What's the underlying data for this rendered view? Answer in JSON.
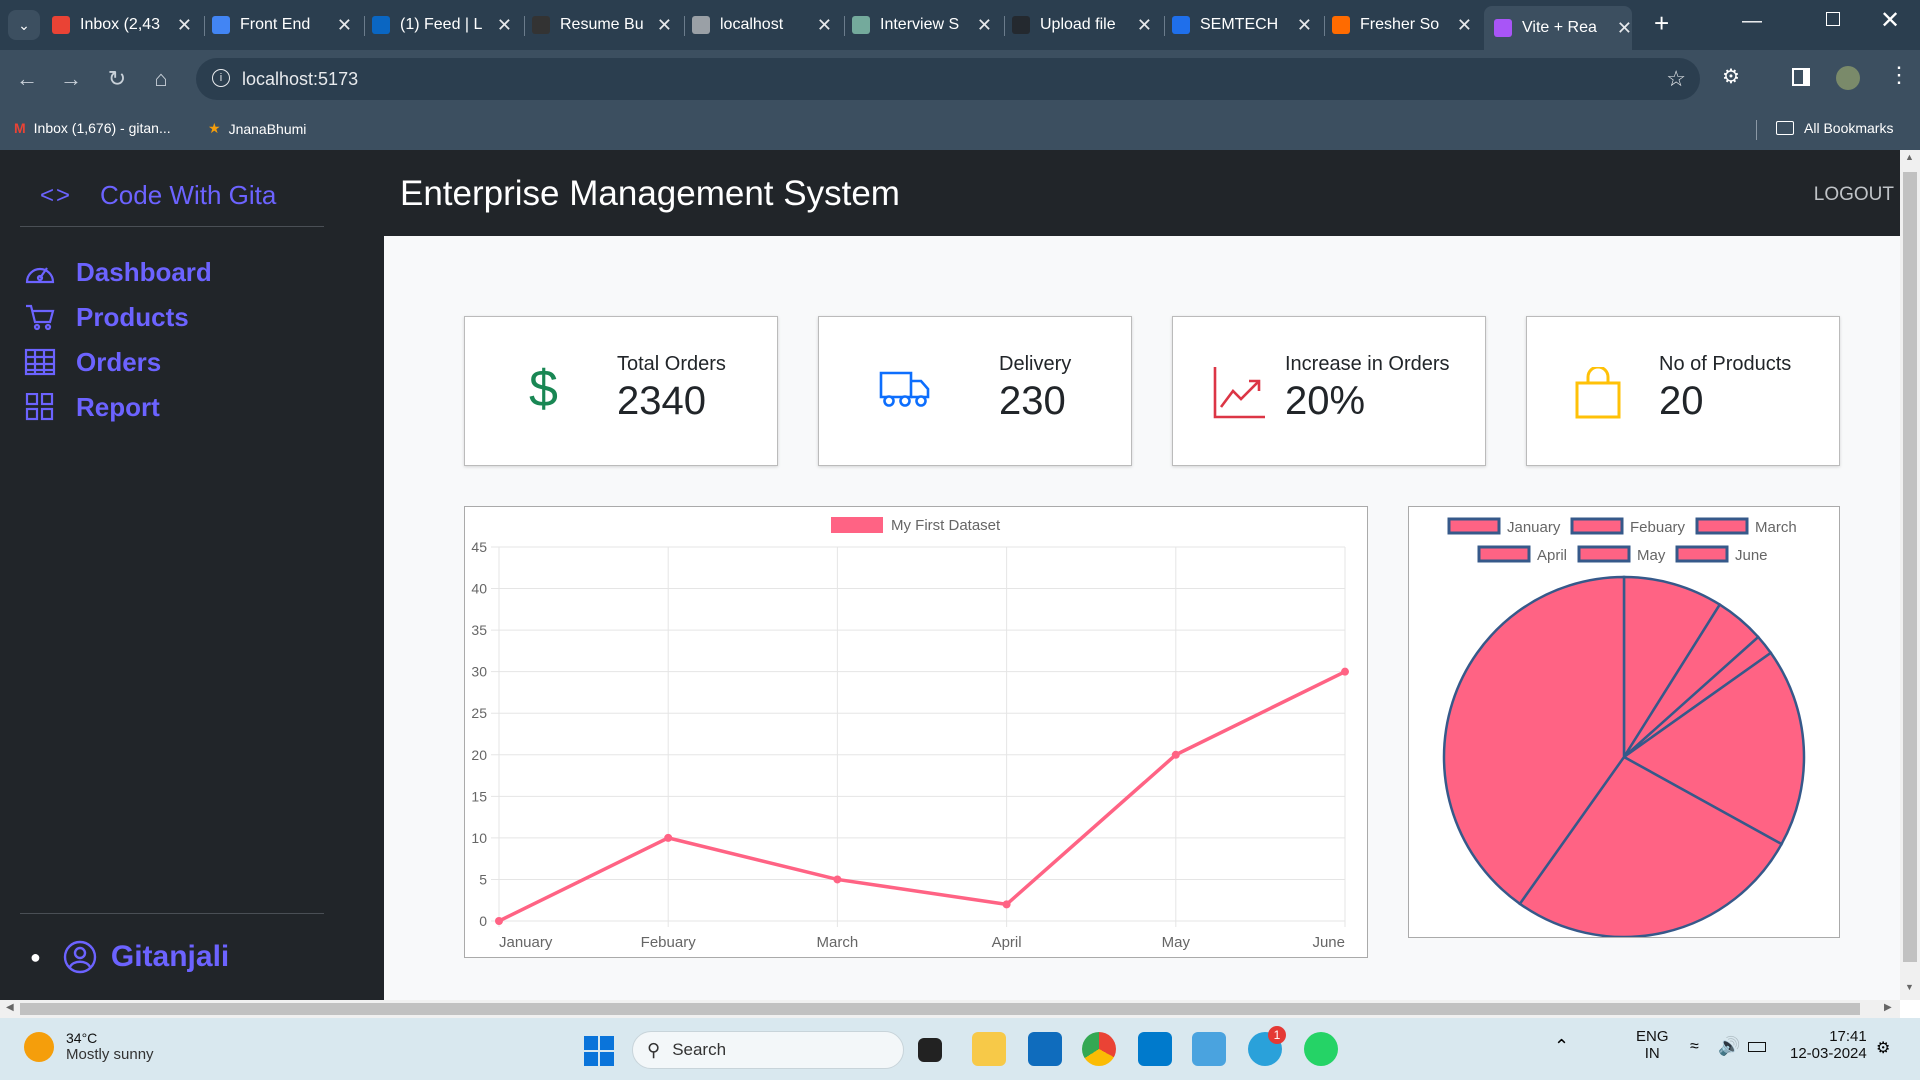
{
  "browser": {
    "tabs": [
      {
        "label": "Inbox (2,43",
        "color": "#ea4335"
      },
      {
        "label": "Front End",
        "color": "#4285f4"
      },
      {
        "label": "(1) Feed | L",
        "color": "#0a66c2"
      },
      {
        "label": "Resume Bu",
        "color": "#333333"
      },
      {
        "label": "localhost",
        "color": "#9aa0a6"
      },
      {
        "label": "Interview S",
        "color": "#74aa9c"
      },
      {
        "label": "Upload file",
        "color": "#24292f"
      },
      {
        "label": "SEMTECH",
        "color": "#1f6feb"
      },
      {
        "label": "Fresher So",
        "color": "#ff6b00"
      },
      {
        "label": "Vite + Rea",
        "color": "#a855f7"
      }
    ],
    "address": "localhost:5173",
    "bookmarks": [
      "Inbox (1,676) - gitan...",
      "JnanaBhumi"
    ],
    "all_bookmarks": "All Bookmarks"
  },
  "sidebar": {
    "brand": "Code With Gita",
    "brand_icon": "code-icon",
    "items": [
      {
        "label": "Dashboard",
        "icon": "speedometer-icon"
      },
      {
        "label": "Products",
        "icon": "cart-icon"
      },
      {
        "label": "Orders",
        "icon": "table-icon"
      },
      {
        "label": "Report",
        "icon": "grid-icon"
      }
    ],
    "user": "Gitanjali"
  },
  "header": {
    "title": "Enterprise Management System",
    "logout": "LOGOUT"
  },
  "cards": [
    {
      "title": "Total Orders",
      "value": "2340",
      "icon": "dollar-icon",
      "color": "#198754"
    },
    {
      "title": "Delivery",
      "value": "230",
      "icon": "truck-icon",
      "color": "#0d6efd"
    },
    {
      "title": "Increase in Orders",
      "value": "20%",
      "icon": "graph-up-icon",
      "color": "#dc3545"
    },
    {
      "title": "No of Products",
      "value": "20",
      "icon": "bag-icon",
      "color": "#ffc107"
    }
  ],
  "chart_data": [
    {
      "type": "line",
      "x": [
        "January",
        "Febuary",
        "March",
        "April",
        "May",
        "June"
      ],
      "series": [
        {
          "name": "My First Dataset",
          "values": [
            0,
            10,
            5,
            2,
            20,
            30
          ]
        }
      ],
      "ylim": [
        0,
        45
      ],
      "yticks": [
        0,
        5,
        10,
        15,
        20,
        25,
        30,
        35,
        40,
        45
      ],
      "grid": true,
      "legend": "top",
      "color": "#ff6384"
    },
    {
      "type": "pie",
      "categories": [
        "January",
        "Febuary",
        "March",
        "April",
        "May",
        "June"
      ],
      "values": [
        10,
        5,
        2,
        20,
        30,
        45
      ],
      "legend": "top",
      "color": "#ff6384",
      "border": "#36598a"
    }
  ],
  "taskbar": {
    "weather_temp": "34°C",
    "weather_desc": "Mostly sunny",
    "search": "Search",
    "lang1": "ENG",
    "lang2": "IN",
    "time": "17:41",
    "date": "12-03-2024",
    "badge": "1"
  }
}
